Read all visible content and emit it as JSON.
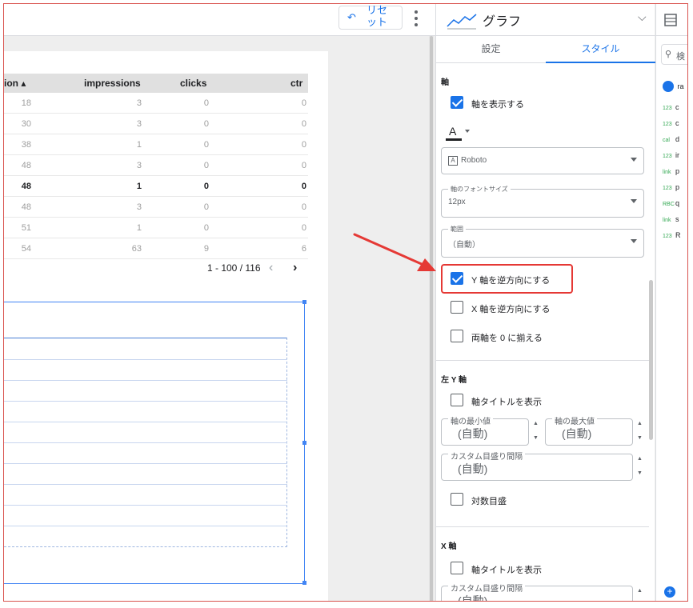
{
  "toolbar": {
    "reset_label": "リセット",
    "more_icon": "more-vert-icon"
  },
  "table": {
    "headers": [
      "ion ▴",
      "impressions",
      "clicks",
      "ctr"
    ],
    "rows": [
      [
        "18",
        "3",
        "0",
        "0"
      ],
      [
        "30",
        "3",
        "0",
        "0"
      ],
      [
        "38",
        "1",
        "0",
        "0"
      ],
      [
        "48",
        "3",
        "0",
        "0"
      ],
      [
        "48",
        "1",
        "0",
        "0"
      ],
      [
        "48",
        "3",
        "0",
        "0"
      ],
      [
        "51",
        "1",
        "0",
        "0"
      ],
      [
        "54",
        "63",
        "9",
        "6"
      ]
    ],
    "bold_row": 4,
    "pager_text": "1 - 100 / 116"
  },
  "props": {
    "chart_type": "グラフ",
    "tabs": [
      "設定",
      "スタイル"
    ],
    "active_tab": 1,
    "axis_section": "軸",
    "show_axis": "軸を表示する",
    "font_color_icon": "A",
    "font_family": "Roboto",
    "font_size_label": "軸のフォントサイズ",
    "font_size_value": "12px",
    "range_label": "範囲",
    "range_value": "（自動）",
    "reverse_y": "Y 軸を逆方向にする",
    "reverse_x": "X 軸を逆方向にする",
    "align_zero": "両軸を 0 に揃える",
    "left_y_section": "左 Y 軸",
    "show_axis_title": "軸タイトルを表示",
    "axis_min_label": "軸の最小値",
    "axis_max_label": "軸の最大値",
    "auto_value": "(自動)",
    "tick_interval_label": "カスタム目盛り間隔",
    "log_scale": "対数目盛",
    "x_section": "X 軸",
    "show_axis_title_x": "軸タイトルを表示",
    "tick_interval_label_x": "カスタム目盛り間隔",
    "checked": {
      "show_axis": true,
      "reverse_y": true,
      "reverse_x": false,
      "align_zero": false,
      "show_axis_title": false,
      "log_scale": false,
      "show_axis_title_x": false
    }
  },
  "data_panel": {
    "search_placeholder": "検",
    "source": "ra",
    "fields": [
      {
        "type": "123",
        "name": "c"
      },
      {
        "type": "123",
        "name": "c"
      },
      {
        "type": "cal",
        "name": "d"
      },
      {
        "type": "123",
        "name": "ir"
      },
      {
        "type": "link",
        "name": "p"
      },
      {
        "type": "123",
        "name": "p"
      },
      {
        "type": "RBC",
        "name": "q"
      },
      {
        "type": "link",
        "name": "s"
      },
      {
        "type": "123",
        "name": "R"
      }
    ]
  },
  "colors": {
    "accent": "#1a73e8",
    "highlight": "#e53935",
    "arrow": "#e53935"
  }
}
